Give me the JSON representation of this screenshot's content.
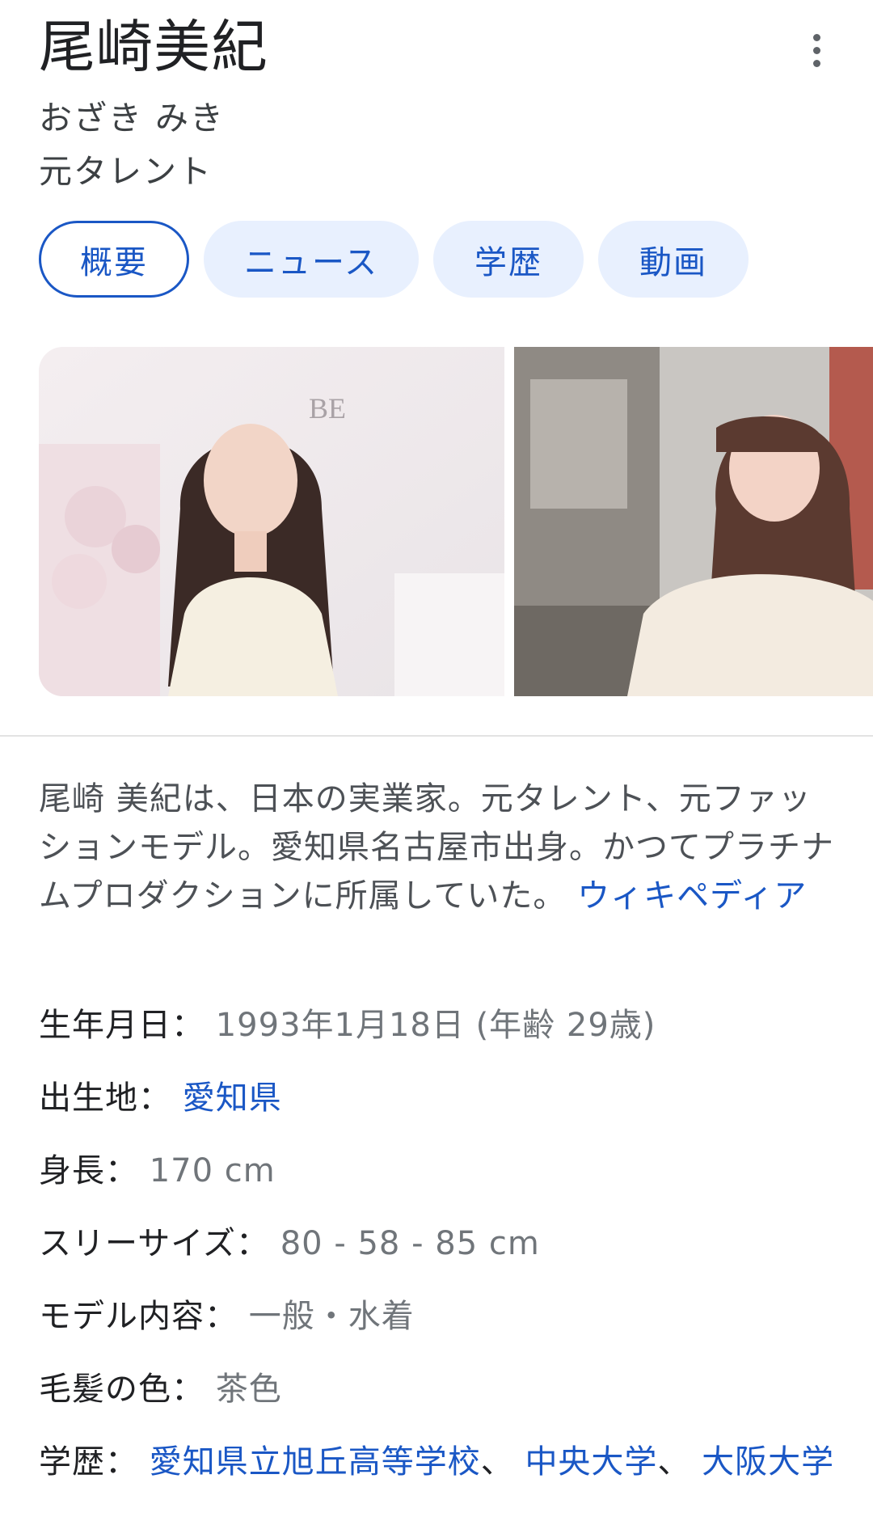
{
  "entity": {
    "name": "尾崎美紀",
    "reading": "おざき みき",
    "category": "元タレント"
  },
  "tabs": [
    "概要",
    "ニュース",
    "学歴",
    "動画"
  ],
  "images": [
    {
      "alt": "",
      "sign": "BE"
    },
    {
      "alt": ""
    }
  ],
  "description": {
    "text": "尾崎 美紀は、日本の実業家。元タレント、元ファッションモデル。愛知県名古屋市出身。かつてプラチナムプロダクションに所属していた。",
    "source_link": "ウィキペディア"
  },
  "facts": {
    "birth": {
      "label": "生年月日：",
      "value": "1993年1月18日 (年齢 29歳)"
    },
    "birthplace": {
      "label": "出生地：",
      "value": "愛知県"
    },
    "height": {
      "label": "身長：",
      "value": "170 cm"
    },
    "measurements": {
      "label": "スリーサイズ：",
      "value": "80 - 58 - 85 cm"
    },
    "model_type": {
      "label": "モデル内容：",
      "value": "一般・水着"
    },
    "hair_color": {
      "label": "毛髪の色：",
      "value": "茶色"
    },
    "education": {
      "label": "学歴：",
      "schools": [
        "愛知県立旭丘高等学校",
        "中央大学",
        "大阪大学"
      ],
      "separator": "、 "
    }
  },
  "colors": {
    "link": "#1a57c5",
    "chip_bg": "#e8f0fe",
    "muted_text": "#70757a"
  },
  "icons": {
    "more": "more-vert-icon"
  }
}
